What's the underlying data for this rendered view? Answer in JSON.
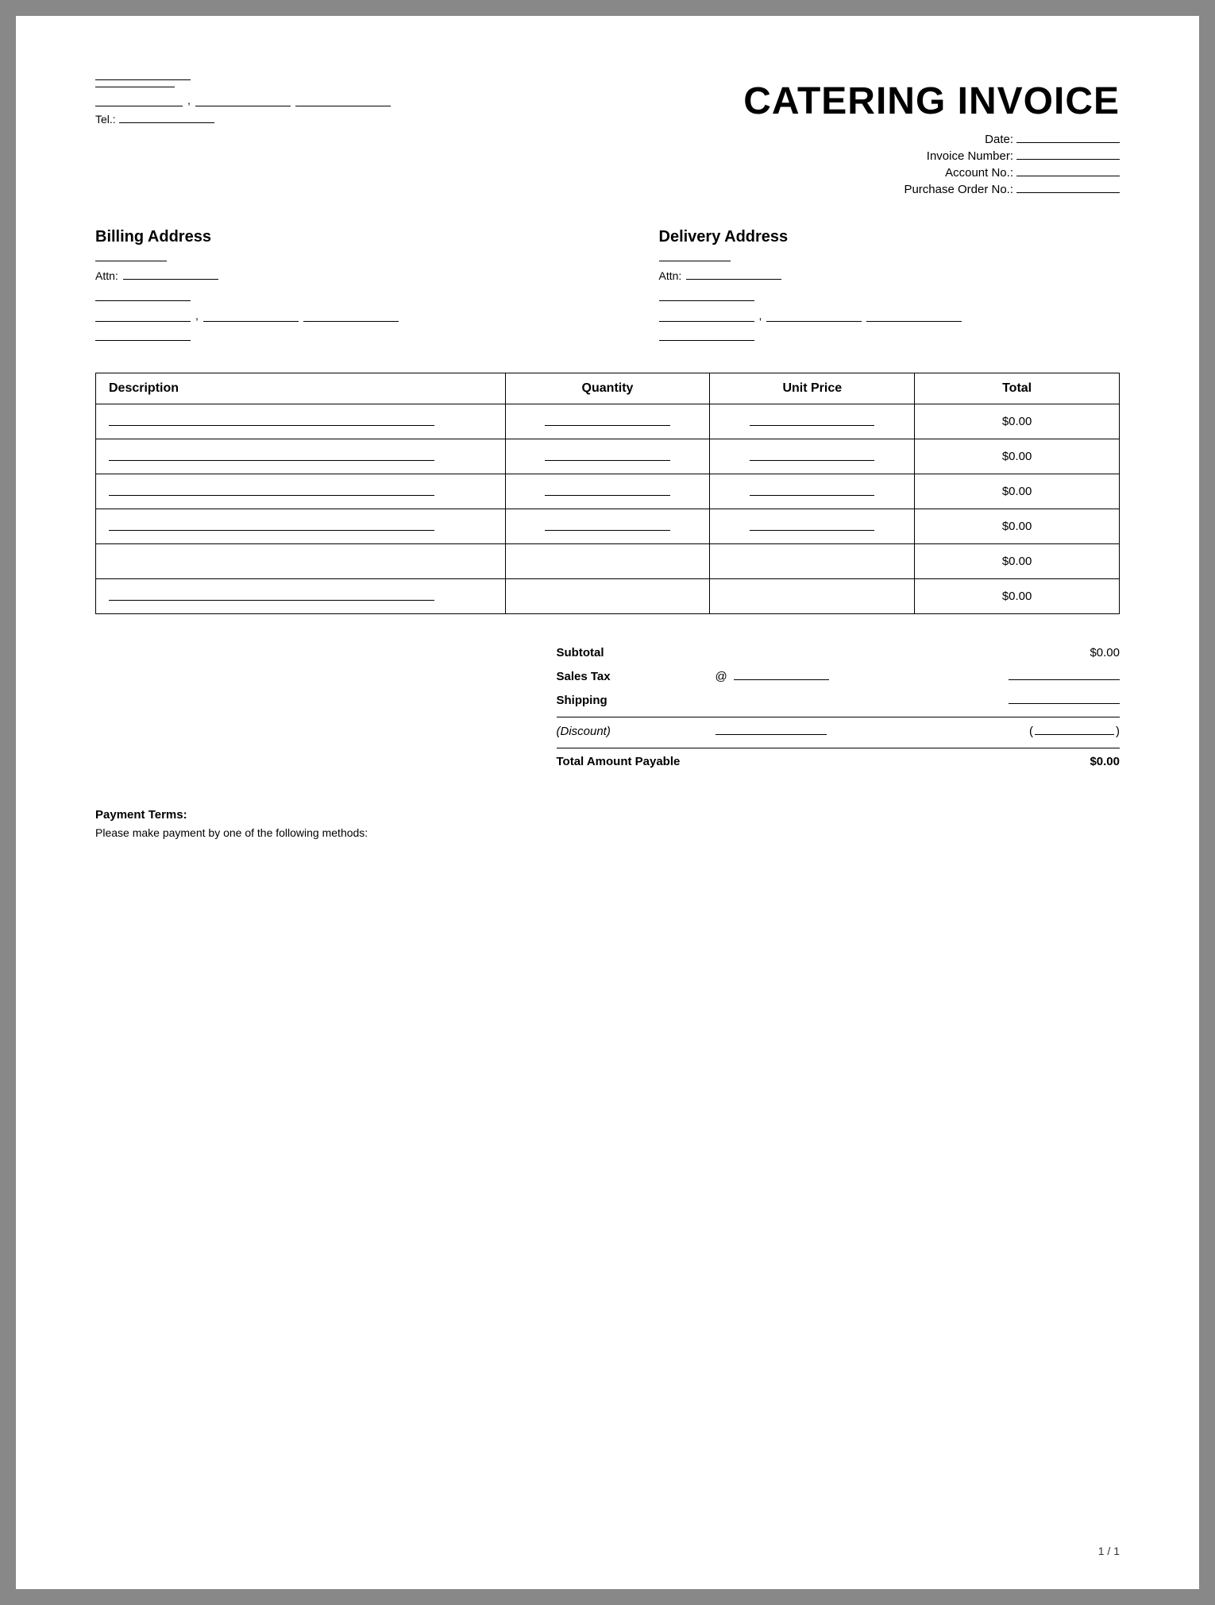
{
  "page": {
    "title": "CATERING INVOICE",
    "page_number": "1 / 1"
  },
  "header": {
    "left": {
      "name_blank_label": "",
      "address_blank_label": "",
      "city_blank_label": "",
      "state_blank_label": "",
      "zip_blank_label": "",
      "tel_label": "Tel.:",
      "tel_blank": ""
    },
    "right": {
      "date_label": "Date:",
      "invoice_number_label": "Invoice Number:",
      "account_no_label": "Account No.:",
      "purchase_order_label": "Purchase Order No.:"
    }
  },
  "billing": {
    "title": "Billing Address",
    "attn_label": "Attn:",
    "attn_blank": ""
  },
  "delivery": {
    "title": "Delivery Address",
    "attn_label": "Attn:",
    "attn_blank": ""
  },
  "table": {
    "columns": {
      "description": "Description",
      "quantity": "Quantity",
      "unit_price": "Unit Price",
      "total": "Total"
    },
    "rows": [
      {
        "total": "$0.00"
      },
      {
        "total": "$0.00"
      },
      {
        "total": "$0.00"
      },
      {
        "total": "$0.00"
      },
      {
        "total": "$0.00"
      },
      {
        "total": "$0.00"
      }
    ]
  },
  "totals": {
    "subtotal_label": "Subtotal",
    "subtotal_value": "$0.00",
    "sales_tax_label": "Sales Tax",
    "sales_tax_at": "@",
    "shipping_label": "Shipping",
    "discount_label": "(Discount)",
    "total_label": "Total Amount Payable",
    "total_value": "$0.00"
  },
  "payment": {
    "title": "Payment Terms:",
    "text": "Please make payment by one of the following methods:"
  }
}
